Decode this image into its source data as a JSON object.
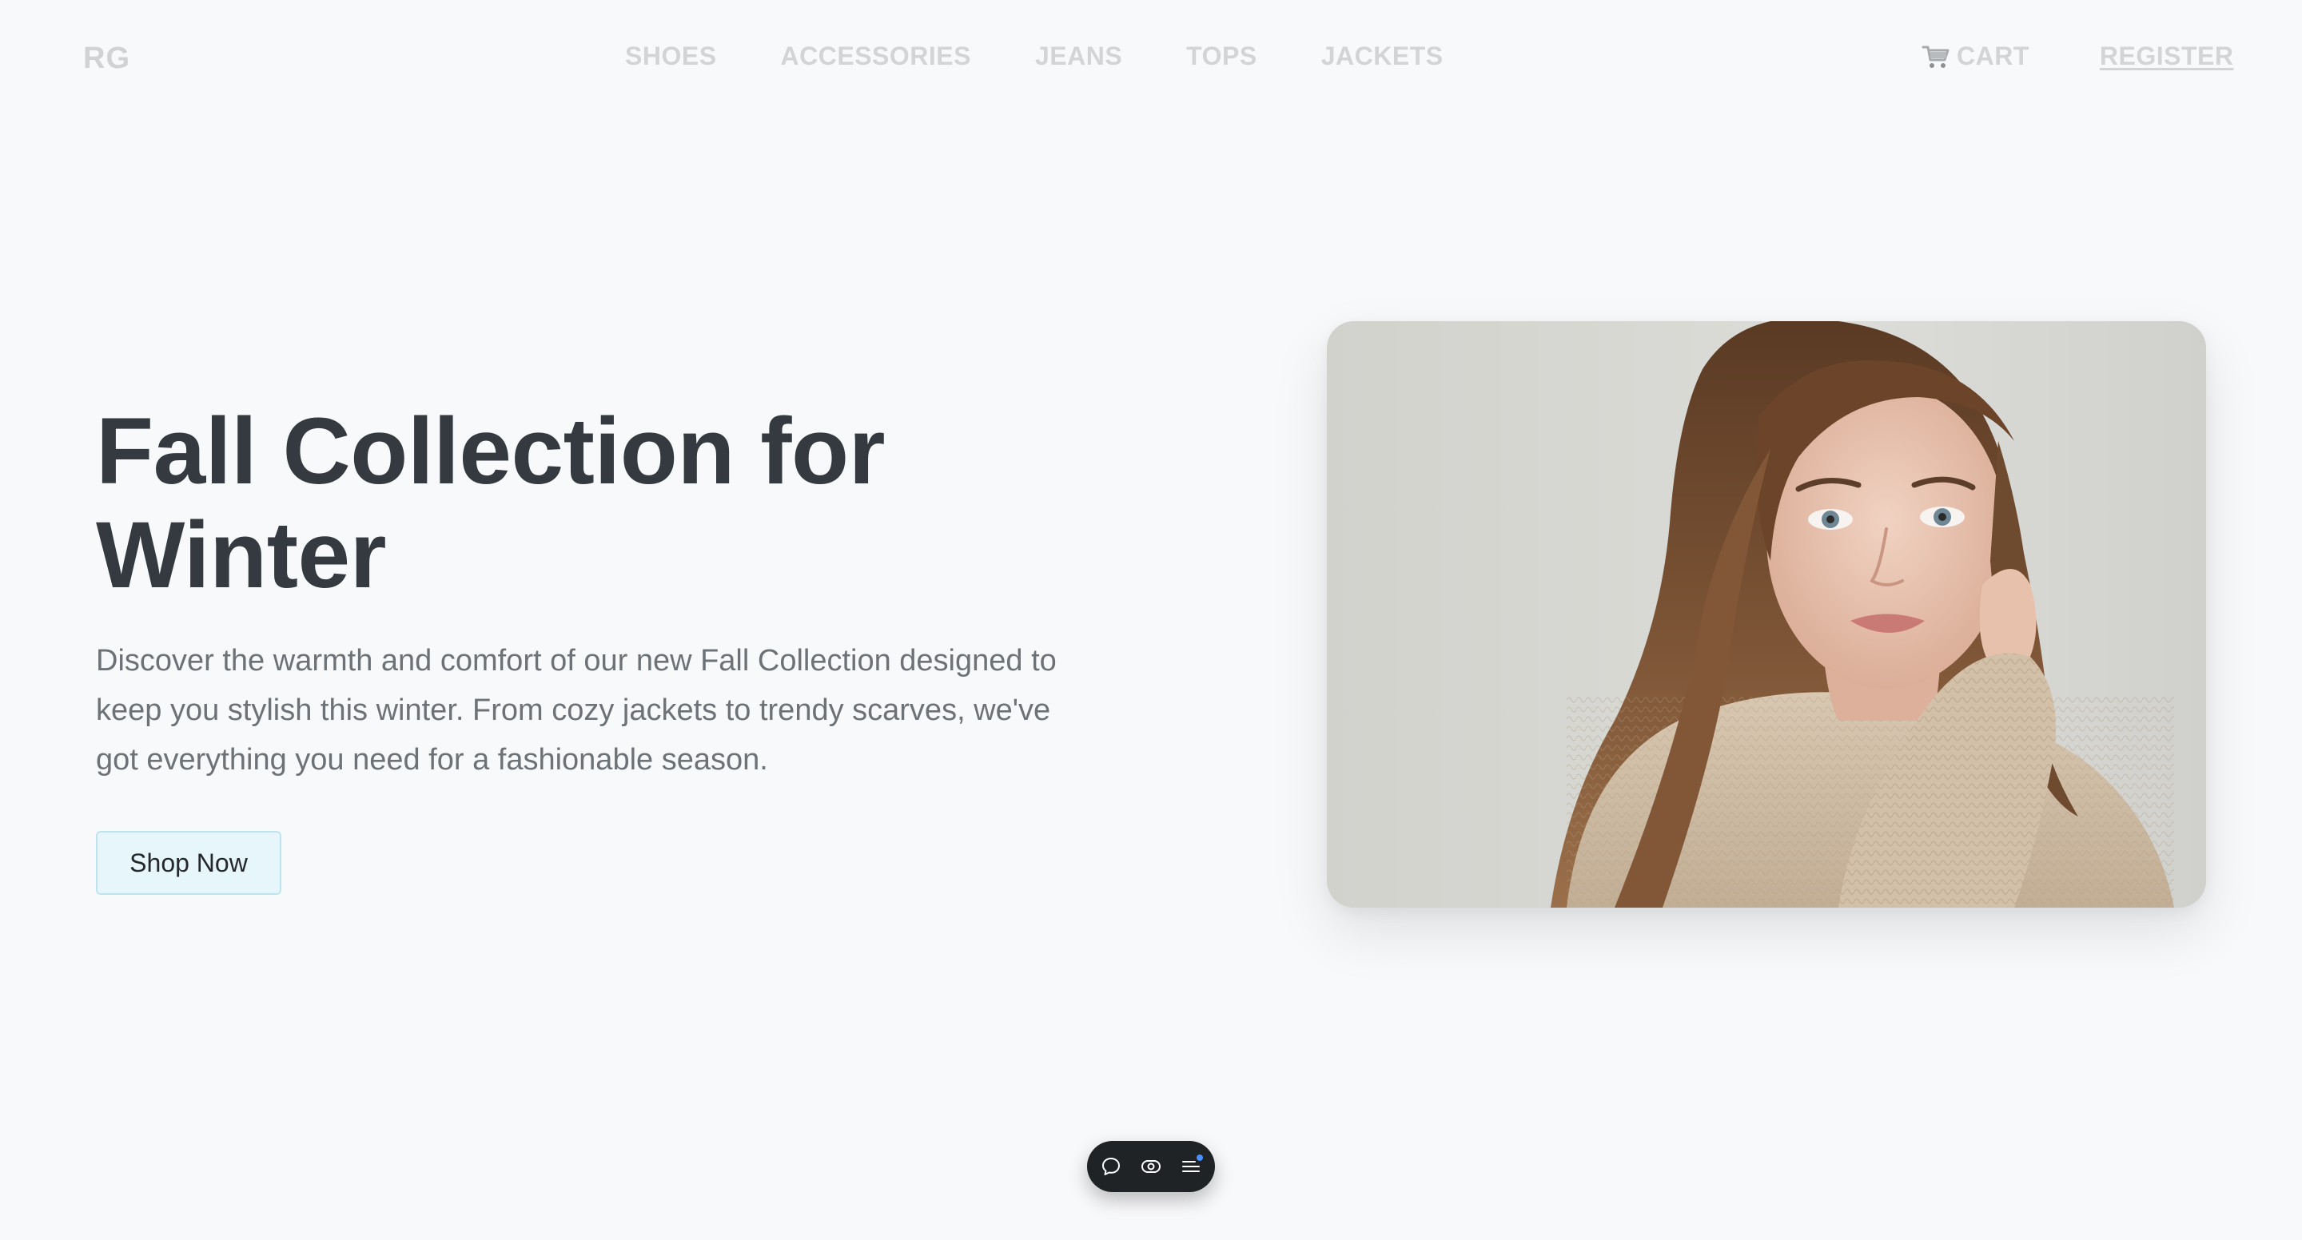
{
  "header": {
    "logo": "RG",
    "nav": [
      {
        "label": "SHOES"
      },
      {
        "label": "ACCESSORIES"
      },
      {
        "label": "JEANS"
      },
      {
        "label": "TOPS"
      },
      {
        "label": "JACKETS"
      }
    ],
    "cart_label": "CART",
    "register_label": "REGISTER"
  },
  "hero": {
    "title": "Fall Collection for Winter",
    "description": "Discover the warmth and comfort of our new Fall Collection designed to keep you stylish this winter. From cozy jackets to trendy scarves, we've got everything you need for a fashionable season.",
    "cta_label": "Shop Now"
  },
  "toolbar": {
    "icons": [
      "comment-icon",
      "view-icon",
      "menu-icon"
    ],
    "notification_color": "#4a90ff"
  },
  "colors": {
    "background": "#f8f9fb",
    "title": "#353a40",
    "body_text": "#6d7277",
    "nav_text": "#d2d4d6",
    "button_bg": "#e6f6fa",
    "button_border": "#bfe4ef"
  }
}
